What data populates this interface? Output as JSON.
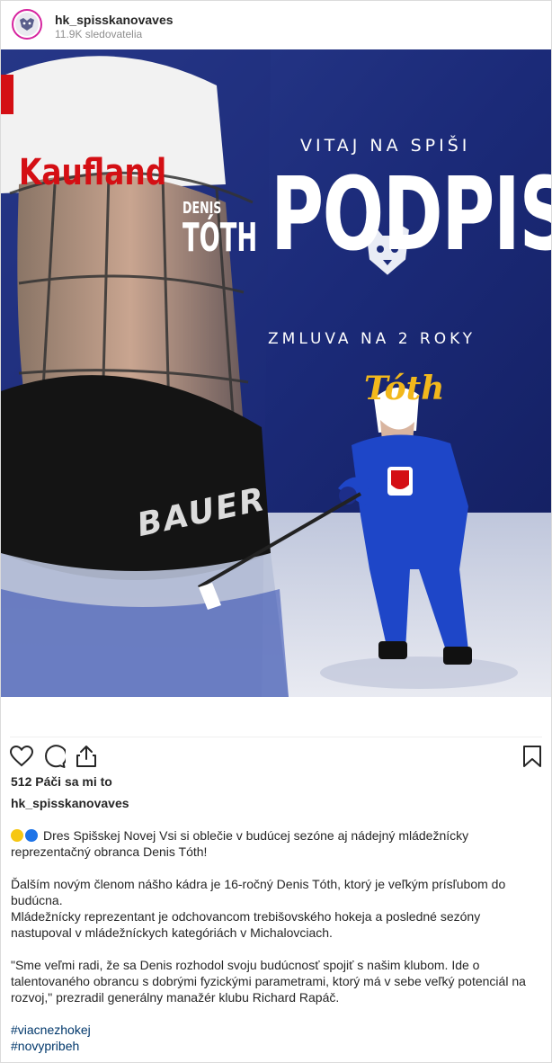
{
  "header": {
    "username": "hk_spisskanovaves",
    "followers": "11.9K sledovatelia",
    "avatar_icon": "club-logo-icon"
  },
  "image": {
    "kaufland_text": "Kaufland",
    "denis_text": "DENIS",
    "toth_text": "TÓTH",
    "bauer_text": "BAUER",
    "vitaj_text": "VITAJ NA SPIŠI",
    "podpis_text": "PODPIS",
    "zmluva_text": "ZMLUVA NA 2 ROKY",
    "signature_text": "Tóth",
    "colors": {
      "navy": "#1b2a78",
      "yellow": "#f2b81c",
      "red": "#d40f14",
      "jersey_blue": "#1e46c8"
    }
  },
  "actions": {
    "like_icon": "heart-icon",
    "comment_icon": "comment-icon",
    "share_icon": "share-icon",
    "save_icon": "bookmark-icon"
  },
  "likes": "512 Páči sa mi to",
  "caption": {
    "username": "hk_spisskanovaves",
    "line1": "Dres Spišskej Novej Vsi si oblečie v budúcej sezóne aj nádejný mládežnícky reprezentačný obranca Denis Tóth!",
    "line2": "Ďalším novým členom nášho kádra je 16-ročný Denis Tóth, ktorý je veľkým prísľubom do budúcna.",
    "line3": "Mládežnícky reprezentant je odchovancom trebišovského hokeja a posledné sezóny nastupoval v mládežníckych kategóriách v Michalovciach.",
    "line4": "\"Sme veľmi radi, že sa Denis rozhodol svoju budúcnosť spojiť s našim klubom. Ide o talentovaného obrancu s dobrými fyzickými parametrami, ktorý má v sebe veľký potenciál na rozvoj,\" prezradil generálny manažér klubu Richard Rapáč.",
    "hashtag1": "#viacnezhokej",
    "hashtag2": "#novypribeh"
  }
}
